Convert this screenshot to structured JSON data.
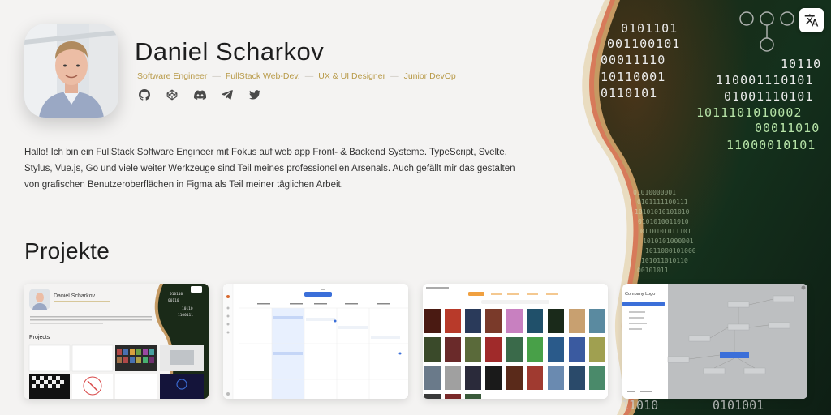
{
  "profile": {
    "name": "Daniel Scharkov",
    "roles": [
      "Software Engineer",
      "FullStack Web-Dev.",
      "UX & UI Designer",
      "Junior DevOp"
    ],
    "role_separator": "—",
    "socials": [
      "github-icon",
      "codepen-icon",
      "discord-icon",
      "telegram-icon",
      "twitter-icon"
    ],
    "bio": "Hallo! Ich bin ein FullStack Software Engineer mit Fokus auf web app Front- & Backend Systeme. TypeScript, Svelte, Stylus, Vue.js, Go und viele weiter Werkzeuge sind Teil meines professionellen Arsenals. Auch gefällt mir das gestalten von grafischen Benutzeroberflächen in Figma als Teil meiner täglichen Arbeit."
  },
  "projects": {
    "title": "Projekte",
    "cards": [
      {
        "thumb_name": "Daniel Scharkov",
        "thumb_section": "Projects"
      },
      {
        "thumb_kind": "calendar"
      },
      {
        "thumb_kind": "game-library"
      },
      {
        "thumb_title": "Company Logo",
        "thumb_kind": "org-chart"
      }
    ]
  },
  "translate_icon": "translate-icon",
  "colors": {
    "background": "#f4f3f2",
    "role_text": "#b89a48",
    "binary_panel_dark": "#142414",
    "binary_text": "#ececec"
  }
}
